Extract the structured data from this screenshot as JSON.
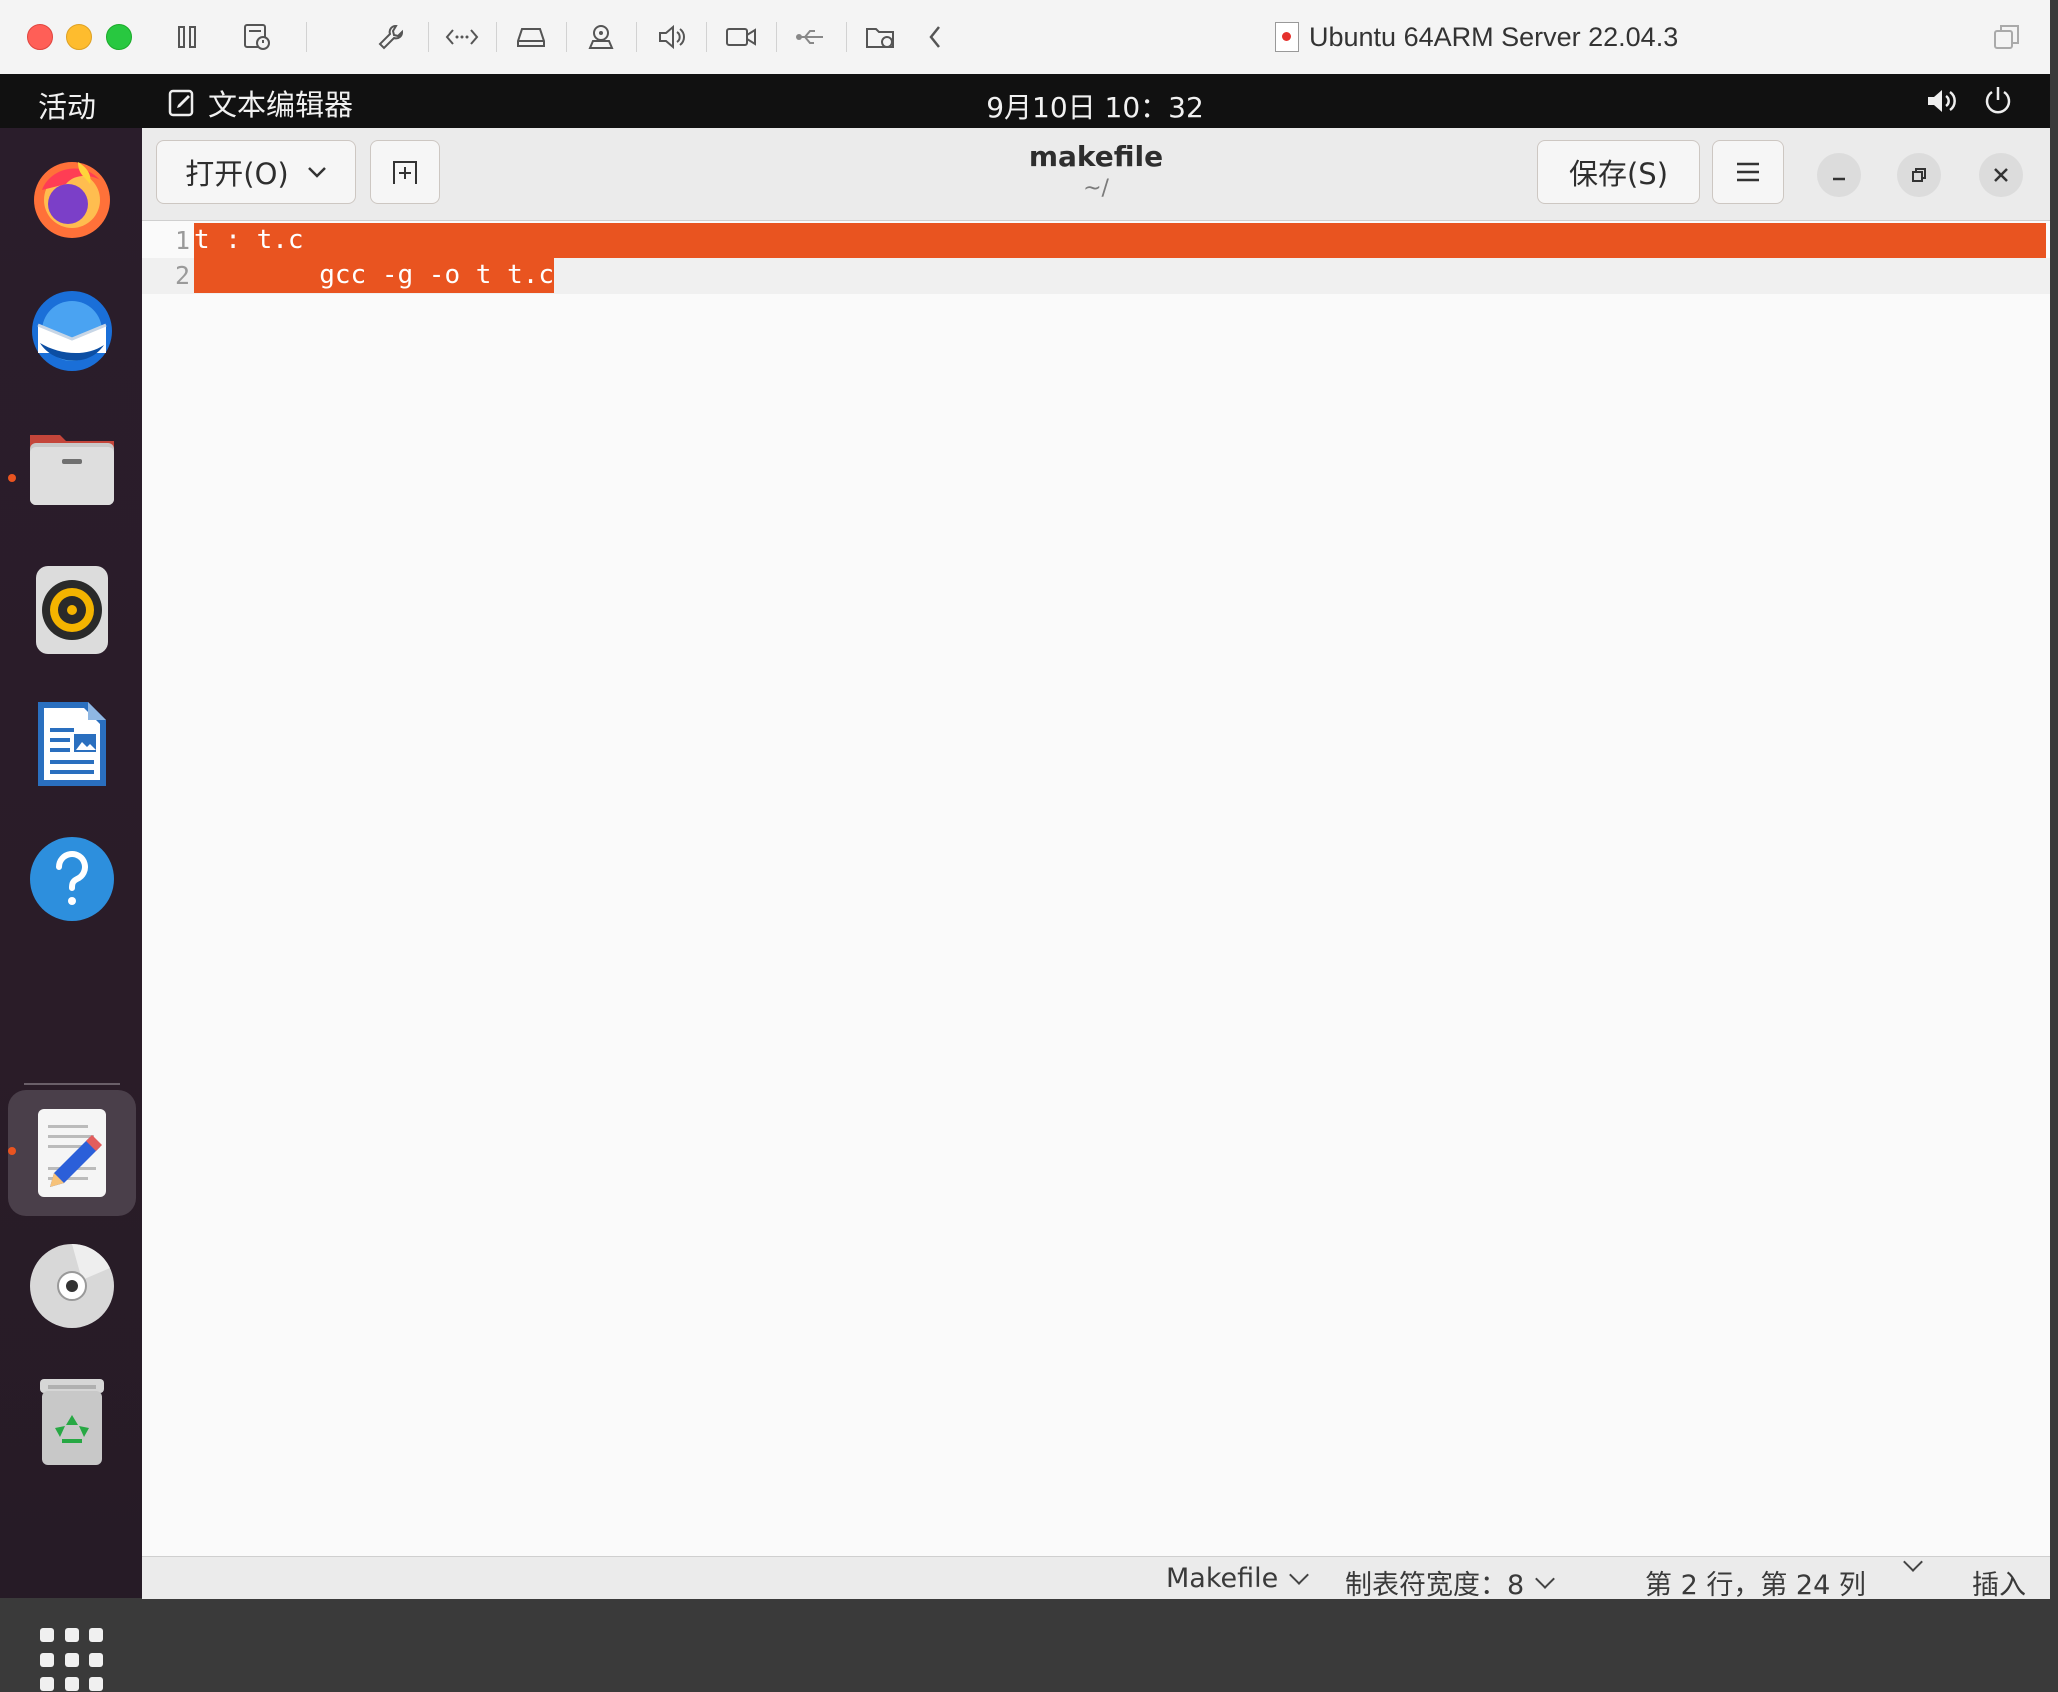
{
  "host_window": {
    "title": "Ubuntu 64ARM Server 22.04.3"
  },
  "ubuntu_topbar": {
    "activities": "活动",
    "app_name": "文本编辑器",
    "clock": "9月10日 10：32"
  },
  "dock": {
    "apps": [
      "firefox",
      "thunderbird",
      "files",
      "rhythmbox",
      "libreoffice-writer",
      "help",
      "text-editor",
      "optical-disc",
      "trash"
    ]
  },
  "editor": {
    "open_label": "打开(O)",
    "save_label": "保存(S)",
    "doc_title": "makefile",
    "doc_subtitle": "~/",
    "lines": [
      {
        "number": "1",
        "text": "t : t.c"
      },
      {
        "number": "2",
        "text": "        gcc -g -o t t.c"
      }
    ],
    "selection_color": "#e95420"
  },
  "statusbar": {
    "language": "Makefile",
    "tab_width": "制表符宽度：8",
    "position": "第 2 行，第 24 列",
    "mode": "插入"
  }
}
